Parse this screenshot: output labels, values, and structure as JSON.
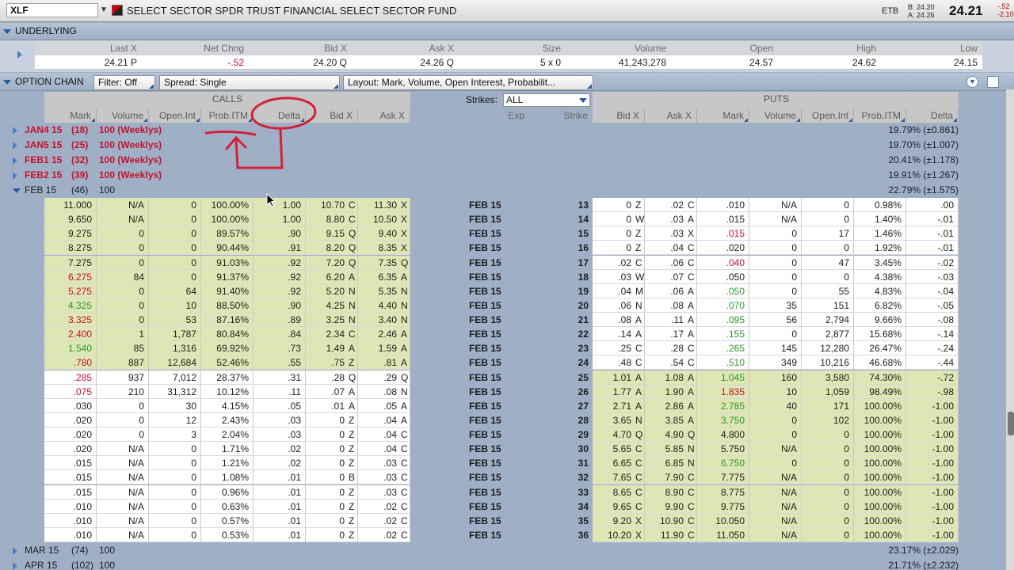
{
  "topbar": {
    "symbol": "XLF",
    "instrument_name": "SELECT SECTOR SPDR TRUST FINANCIAL SELECT SECTOR FUND",
    "etb": "ETB",
    "bid_mini": "B: 24.20",
    "ask_mini": "A: 24.26",
    "last": "24.21",
    "chg_mini": "-.52",
    "pct_mini": "-2.10"
  },
  "underlying": {
    "title": "UNDERLYING",
    "headers": [
      "Last X",
      "Net Chng",
      "Bid X",
      "Ask X",
      "Size",
      "Volume",
      "Open",
      "High",
      "Low"
    ],
    "values": [
      "24.21 P",
      "-.52",
      "24.20 Q",
      "24.26 Q",
      "5 x 0",
      "41,243,278",
      "24.57",
      "24.62",
      "24.15"
    ]
  },
  "option_chain": {
    "title": "OPTION CHAIN",
    "filter": "Filter: Off",
    "spread": "Spread: Single",
    "layout": "Layout: Mark, Volume, Open Interest, Probabilit...",
    "calls_label": "CALLS",
    "puts_label": "PUTS",
    "strikes_label": "Strikes:",
    "strikes_value": "ALL",
    "call_headers": [
      "Mark",
      "Volume",
      "Open.Int",
      "Prob.ITM",
      "Delta",
      "Bid X",
      "Ask X"
    ],
    "mid_headers": [
      "Exp",
      "Strike"
    ],
    "put_headers": [
      "Bid X",
      "Ask X",
      "Mark",
      "Volume",
      "Open.Int",
      "Prob.ITM",
      "Delta"
    ]
  },
  "series_above": [
    {
      "exp": "JAN4 15",
      "days": "(18)",
      "mult": "100 (Weeklys)",
      "iv": "19.79% (±0.861)"
    },
    {
      "exp": "JAN5 15",
      "days": "(25)",
      "mult": "100 (Weeklys)",
      "iv": "19.70% (±1.007)"
    },
    {
      "exp": "FEB1 15",
      "days": "(32)",
      "mult": "100 (Weeklys)",
      "iv": "20.41% (±1.178)"
    },
    {
      "exp": "FEB2 15",
      "days": "(39)",
      "mult": "100 (Weeklys)",
      "iv": "19.91% (±1.267)"
    }
  ],
  "series_open": {
    "exp": "FEB 15",
    "days": "(46)",
    "mult": "100",
    "iv": "22.79% (±1.575)"
  },
  "series_below": [
    {
      "exp": "MAR 15",
      "days": "(74)",
      "mult": "100",
      "iv": "23.17% (±2.029)"
    },
    {
      "exp": "APR 15",
      "days": "(102)",
      "mult": "100",
      "iv": "21.71% (±2.232)"
    }
  ],
  "rows": [
    {
      "cm": "11.000",
      "cv": "N/A",
      "co": "0",
      "cp": "100.00%",
      "cd": "1.00",
      "cb": "10.70",
      "cbx": "C",
      "ca": "11.30",
      "cax": "X",
      "exp": "FEB 15",
      "k": "13",
      "pb": "0",
      "pbx": "Z",
      "pa": ".02",
      "pax": "C",
      "pm": ".010",
      "pv": "N/A",
      "po": "0",
      "pp": "0.98%",
      "pd": ".00",
      "citm": true,
      "pitm": false,
      "cmc": "",
      "pmc": ""
    },
    {
      "cm": "9.650",
      "cv": "N/A",
      "co": "0",
      "cp": "100.00%",
      "cd": "1.00",
      "cb": "8.80",
      "cbx": "C",
      "ca": "10.50",
      "cax": "X",
      "exp": "FEB 15",
      "k": "14",
      "pb": "0",
      "pbx": "W",
      "pa": ".03",
      "pax": "A",
      "pm": ".015",
      "pv": "N/A",
      "po": "0",
      "pp": "1.40%",
      "pd": "-.01",
      "citm": true,
      "pitm": false,
      "cmc": "",
      "pmc": ""
    },
    {
      "cm": "9.275",
      "cv": "0",
      "co": "0",
      "cp": "89.57%",
      "cd": ".90",
      "cb": "9.15",
      "cbx": "Q",
      "ca": "9.40",
      "cax": "X",
      "exp": "FEB 15",
      "k": "15",
      "pb": "0",
      "pbx": "Z",
      "pa": ".03",
      "pax": "X",
      "pm": ".015",
      "pv": "0",
      "po": "17",
      "pp": "1.46%",
      "pd": "-.01",
      "citm": true,
      "pitm": false,
      "cmc": "",
      "pmc": "red"
    },
    {
      "cm": "8.275",
      "cv": "0",
      "co": "0",
      "cp": "90.44%",
      "cd": ".91",
      "cb": "8.20",
      "cbx": "Q",
      "ca": "8.35",
      "cax": "X",
      "exp": "FEB 15",
      "k": "16",
      "pb": "0",
      "pbx": "Z",
      "pa": ".04",
      "pax": "C",
      "pm": ".020",
      "pv": "0",
      "po": "0",
      "pp": "1.92%",
      "pd": "-.01",
      "citm": true,
      "pitm": false,
      "cmc": "",
      "pmc": ""
    },
    {
      "cm": "7.275",
      "cv": "0",
      "co": "0",
      "cp": "91.03%",
      "cd": ".92",
      "cb": "7.20",
      "cbx": "Q",
      "ca": "7.35",
      "cax": "Q",
      "exp": "FEB 15",
      "k": "17",
      "pb": ".02",
      "pbx": "C",
      "pa": ".06",
      "pax": "C",
      "pm": ".040",
      "pv": "0",
      "po": "47",
      "pp": "3.45%",
      "pd": "-.02",
      "citm": true,
      "pitm": false,
      "cmc": "",
      "pmc": "red"
    },
    {
      "cm": "6.275",
      "cv": "84",
      "co": "0",
      "cp": "91.37%",
      "cd": ".92",
      "cb": "6.20",
      "cbx": "A",
      "ca": "6.35",
      "cax": "A",
      "exp": "FEB 15",
      "k": "18",
      "pb": ".03",
      "pbx": "W",
      "pa": ".07",
      "pax": "C",
      "pm": ".050",
      "pv": "0",
      "po": "0",
      "pp": "4.38%",
      "pd": "-.03",
      "citm": true,
      "pitm": false,
      "cmc": "red",
      "pmc": ""
    },
    {
      "cm": "5.275",
      "cv": "0",
      "co": "64",
      "cp": "91.40%",
      "cd": ".92",
      "cb": "5.20",
      "cbx": "N",
      "ca": "5.35",
      "cax": "N",
      "exp": "FEB 15",
      "k": "19",
      "pb": ".04",
      "pbx": "M",
      "pa": ".06",
      "pax": "A",
      "pm": ".050",
      "pv": "0",
      "po": "55",
      "pp": "4.83%",
      "pd": "-.04",
      "citm": true,
      "pitm": false,
      "cmc": "red",
      "pmc": "green"
    },
    {
      "cm": "4.325",
      "cv": "0",
      "co": "10",
      "cp": "88.50%",
      "cd": ".90",
      "cb": "4.25",
      "cbx": "N",
      "ca": "4.40",
      "cax": "N",
      "exp": "FEB 15",
      "k": "20",
      "pb": ".06",
      "pbx": "N",
      "pa": ".08",
      "pax": "A",
      "pm": ".070",
      "pv": "35",
      "po": "151",
      "pp": "6.82%",
      "pd": "-.05",
      "citm": true,
      "pitm": false,
      "cmc": "green",
      "pmc": "green"
    },
    {
      "cm": "3.325",
      "cv": "0",
      "co": "53",
      "cp": "87.16%",
      "cd": ".89",
      "cb": "3.25",
      "cbx": "N",
      "ca": "3.40",
      "cax": "N",
      "exp": "FEB 15",
      "k": "21",
      "pb": ".08",
      "pbx": "A",
      "pa": ".11",
      "pax": "A",
      "pm": ".095",
      "pv": "56",
      "po": "2,794",
      "pp": "9.66%",
      "pd": "-.08",
      "citm": true,
      "pitm": false,
      "cmc": "red",
      "pmc": "green"
    },
    {
      "cm": "2.400",
      "cv": "1",
      "co": "1,787",
      "cp": "80.84%",
      "cd": ".84",
      "cb": "2.34",
      "cbx": "C",
      "ca": "2.46",
      "cax": "A",
      "exp": "FEB 15",
      "k": "22",
      "pb": ".14",
      "pbx": "A",
      "pa": ".17",
      "pax": "A",
      "pm": ".155",
      "pv": "0",
      "po": "2,877",
      "pp": "15.68%",
      "pd": "-.14",
      "citm": true,
      "pitm": false,
      "cmc": "red",
      "pmc": "green"
    },
    {
      "cm": "1.540",
      "cv": "85",
      "co": "1,316",
      "cp": "69.92%",
      "cd": ".73",
      "cb": "1.49",
      "cbx": "A",
      "ca": "1.59",
      "cax": "A",
      "exp": "FEB 15",
      "k": "23",
      "pb": ".25",
      "pbx": "C",
      "pa": ".28",
      "pax": "C",
      "pm": ".265",
      "pv": "145",
      "po": "12,280",
      "pp": "26.47%",
      "pd": "-.24",
      "citm": true,
      "pitm": false,
      "cmc": "green",
      "pmc": "green"
    },
    {
      "cm": ".780",
      "cv": "887",
      "co": "12,684",
      "cp": "52.46%",
      "cd": ".55",
      "cb": ".75",
      "cbx": "Z",
      "ca": ".81",
      "cax": "A",
      "exp": "FEB 15",
      "k": "24",
      "pb": ".48",
      "pbx": "C",
      "pa": ".54",
      "pax": "C",
      "pm": ".510",
      "pv": "349",
      "po": "10,216",
      "pp": "46.68%",
      "pd": "-.44",
      "citm": true,
      "pitm": false,
      "cmc": "red",
      "pmc": "green"
    },
    {
      "cm": ".285",
      "cv": "937",
      "co": "7,012",
      "cp": "28.37%",
      "cd": ".31",
      "cb": ".28",
      "cbx": "Q",
      "ca": ".29",
      "cax": "Q",
      "exp": "FEB 15",
      "k": "25",
      "pb": "1.01",
      "pbx": "A",
      "pa": "1.08",
      "pax": "A",
      "pm": "1.045",
      "pv": "160",
      "po": "3,580",
      "pp": "74.30%",
      "pd": "-.72",
      "citm": false,
      "pitm": true,
      "cmc": "red",
      "pmc": "green"
    },
    {
      "cm": ".075",
      "cv": "210",
      "co": "31,312",
      "cp": "10.12%",
      "cd": ".11",
      "cb": ".07",
      "cbx": "A",
      "ca": ".08",
      "cax": "N",
      "exp": "FEB 15",
      "k": "26",
      "pb": "1.77",
      "pbx": "A",
      "pa": "1.90",
      "pax": "A",
      "pm": "1.835",
      "pv": "10",
      "po": "1,059",
      "pp": "98.49%",
      "pd": "-.98",
      "citm": false,
      "pitm": true,
      "cmc": "red",
      "pmc": "red"
    },
    {
      "cm": ".030",
      "cv": "0",
      "co": "30",
      "cp": "4.15%",
      "cd": ".05",
      "cb": ".01",
      "cbx": "A",
      "ca": ".05",
      "cax": "A",
      "exp": "FEB 15",
      "k": "27",
      "pb": "2.71",
      "pbx": "A",
      "pa": "2.86",
      "pax": "A",
      "pm": "2.785",
      "pv": "40",
      "po": "171",
      "pp": "100.00%",
      "pd": "-1.00",
      "citm": false,
      "pitm": true,
      "cmc": "",
      "pmc": "green"
    },
    {
      "cm": ".020",
      "cv": "0",
      "co": "12",
      "cp": "2.43%",
      "cd": ".03",
      "cb": "0",
      "cbx": "Z",
      "ca": ".04",
      "cax": "A",
      "exp": "FEB 15",
      "k": "28",
      "pb": "3.65",
      "pbx": "N",
      "pa": "3.85",
      "pax": "A",
      "pm": "3.750",
      "pv": "0",
      "po": "102",
      "pp": "100.00%",
      "pd": "-1.00",
      "citm": false,
      "pitm": true,
      "cmc": "",
      "pmc": "green"
    },
    {
      "cm": ".020",
      "cv": "0",
      "co": "3",
      "cp": "2.04%",
      "cd": ".03",
      "cb": "0",
      "cbx": "Z",
      "ca": ".04",
      "cax": "C",
      "exp": "FEB 15",
      "k": "29",
      "pb": "4.70",
      "pbx": "Q",
      "pa": "4.90",
      "pax": "Q",
      "pm": "4.800",
      "pv": "0",
      "po": "0",
      "pp": "100.00%",
      "pd": "-1.00",
      "citm": false,
      "pitm": true,
      "cmc": "",
      "pmc": ""
    },
    {
      "cm": ".020",
      "cv": "N/A",
      "co": "0",
      "cp": "1.71%",
      "cd": ".02",
      "cb": "0",
      "cbx": "Z",
      "ca": ".04",
      "cax": "C",
      "exp": "FEB 15",
      "k": "30",
      "pb": "5.65",
      "pbx": "C",
      "pa": "5.85",
      "pax": "N",
      "pm": "5.750",
      "pv": "N/A",
      "po": "0",
      "pp": "100.00%",
      "pd": "-1.00",
      "citm": false,
      "pitm": true,
      "cmc": "",
      "pmc": ""
    },
    {
      "cm": ".015",
      "cv": "N/A",
      "co": "0",
      "cp": "1.21%",
      "cd": ".02",
      "cb": "0",
      "cbx": "Z",
      "ca": ".03",
      "cax": "C",
      "exp": "FEB 15",
      "k": "31",
      "pb": "6.65",
      "pbx": "C",
      "pa": "6.85",
      "pax": "N",
      "pm": "6.750",
      "pv": "0",
      "po": "0",
      "pp": "100.00%",
      "pd": "-1.00",
      "citm": false,
      "pitm": true,
      "cmc": "",
      "pmc": "green"
    },
    {
      "cm": ".015",
      "cv": "N/A",
      "co": "0",
      "cp": "1.08%",
      "cd": ".01",
      "cb": "0",
      "cbx": "B",
      "ca": ".03",
      "cax": "C",
      "exp": "FEB 15",
      "k": "32",
      "pb": "7.65",
      "pbx": "C",
      "pa": "7.90",
      "pax": "C",
      "pm": "7.775",
      "pv": "N/A",
      "po": "0",
      "pp": "100.00%",
      "pd": "-1.00",
      "citm": false,
      "pitm": true,
      "cmc": "",
      "pmc": ""
    },
    {
      "cm": ".015",
      "cv": "N/A",
      "co": "0",
      "cp": "0.96%",
      "cd": ".01",
      "cb": "0",
      "cbx": "Z",
      "ca": ".03",
      "cax": "C",
      "exp": "FEB 15",
      "k": "33",
      "pb": "8.65",
      "pbx": "C",
      "pa": "8.90",
      "pax": "C",
      "pm": "8.775",
      "pv": "N/A",
      "po": "0",
      "pp": "100.00%",
      "pd": "-1.00",
      "citm": false,
      "pitm": true,
      "cmc": "",
      "pmc": ""
    },
    {
      "cm": ".010",
      "cv": "N/A",
      "co": "0",
      "cp": "0.63%",
      "cd": ".01",
      "cb": "0",
      "cbx": "Z",
      "ca": ".02",
      "cax": "C",
      "exp": "FEB 15",
      "k": "34",
      "pb": "9.65",
      "pbx": "C",
      "pa": "9.90",
      "pax": "C",
      "pm": "9.775",
      "pv": "N/A",
      "po": "0",
      "pp": "100.00%",
      "pd": "-1.00",
      "citm": false,
      "pitm": true,
      "cmc": "",
      "pmc": ""
    },
    {
      "cm": ".010",
      "cv": "N/A",
      "co": "0",
      "cp": "0.57%",
      "cd": ".01",
      "cb": "0",
      "cbx": "Z",
      "ca": ".02",
      "cax": "C",
      "exp": "FEB 15",
      "k": "35",
      "pb": "9.20",
      "pbx": "X",
      "pa": "10.90",
      "pax": "C",
      "pm": "10.050",
      "pv": "N/A",
      "po": "0",
      "pp": "100.00%",
      "pd": "-1.00",
      "citm": false,
      "pitm": true,
      "cmc": "",
      "pmc": ""
    },
    {
      "cm": ".010",
      "cv": "N/A",
      "co": "0",
      "cp": "0.53%",
      "cd": ".01",
      "cb": "0",
      "cbx": "Z",
      "ca": ".02",
      "cax": "C",
      "exp": "FEB 15",
      "k": "36",
      "pb": "10.20",
      "pbx": "X",
      "pa": "11.90",
      "pax": "C",
      "pm": "11.050",
      "pv": "N/A",
      "po": "0",
      "pp": "100.00%",
      "pd": "-1.00",
      "citm": false,
      "pitm": true,
      "cmc": "",
      "pmc": ""
    }
  ],
  "colors": {
    "itm_bg": "#dfe6b5",
    "otm_bg": "#ffffff",
    "up": "#2a9a2a",
    "down": "#c4122f",
    "annotation": "#d3203a",
    "header_blue": "#9eb0c7"
  }
}
